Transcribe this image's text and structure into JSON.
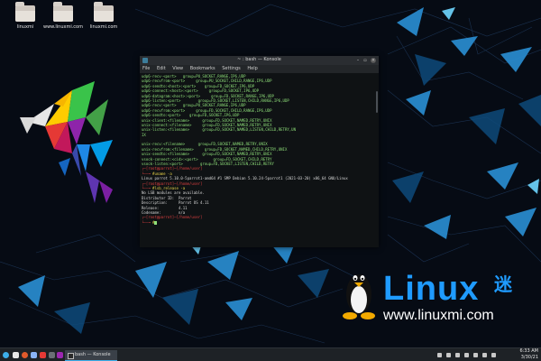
{
  "desktop": {
    "icons": [
      {
        "label": "linuxmi"
      },
      {
        "label": "www.linuxmi.com"
      },
      {
        "label": "linuxmi.com"
      }
    ]
  },
  "window": {
    "title": "~ : bash — Konsole",
    "menu": [
      "File",
      "Edit",
      "View",
      "Bookmarks",
      "Settings",
      "Help"
    ]
  },
  "terminal": {
    "lines": [
      {
        "t": "udp6-recv-<port>   group=PU_SOCKET,RANGE,IP6,UDP",
        "c": "grn"
      },
      {
        "t": "udp6-recvfrom-<port>     group=PU_SOCKET,CHILD,RANGE,IP6,UDP",
        "c": "grn"
      },
      {
        "t": "udp6-sendto:<host>:<port>    group=FD,SOCKET,IP6,UDP",
        "c": "grn"
      },
      {
        "t": "udp6-connect:<host>:<port>     group=FD,SOCKET,IP6,UDP",
        "c": "grn"
      },
      {
        "t": "udp6-datagram:<host>:<port>     group=FD,SOCKET,RANGE,IP6,UDP",
        "c": "grn"
      },
      {
        "t": "udp6-listen:<port>        group=FD,SOCKET,LISTEN,CHILD,RANGE,IP6,UDP",
        "c": "grn"
      },
      {
        "t": "udp6-recv:<port>   group=PU_SOCKET,RANGE,IP6,UDP",
        "c": "grn"
      },
      {
        "t": "udp6-recvfrom:<port>     group=FD,SOCKET,CHILD,RANGE,IP6,UDP",
        "c": "grn"
      },
      {
        "t": "udp6-sendto:<port>    group=FD,SOCKET,IP6,UDP",
        "c": "grn"
      },
      {
        "t": "unix-client:<filename>      group=FD,SOCKET,NAMED,RETRY,UNIX",
        "c": "grn"
      },
      {
        "t": "unix-connect:<filename>     group=FD,SOCKET,NAMED,RETRY,UNIX",
        "c": "grn"
      },
      {
        "t": "unix-listen:<filename>      group=FD,SOCKET,NAMED,LISTEN,CHILD,RETRY,UN",
        "c": "grn"
      },
      {
        "t": "IX",
        "c": "grn"
      },
      {
        "t": "",
        "c": "grn"
      },
      {
        "t": "unix-recv:<filename>      group=FD,SOCKET,NAMED,RETRY,UNIX",
        "c": "grn"
      },
      {
        "t": "unix-recvfrom:<filename>     group=FD,SOCKET,NAMED,CHILD,RETRY,UNIX",
        "c": "grn"
      },
      {
        "t": "unix-sendto:<filename>      group=FD,SOCKET,NAMED,RETRY,UNIX",
        "c": "grn"
      },
      {
        "t": "vsock-connect:<cid>:<port>       group=FD,SOCKET,CHILD,RETRY",
        "c": "grn"
      },
      {
        "t": "vsock-listen:<port>        group=FD,SOCKET,LISTEN,CHILD,RETRY",
        "c": "grn"
      }
    ],
    "prompt1_user": "[root@parrot]",
    "prompt1_path": "[/home/user]",
    "cmd1": "#uname -a",
    "out1": "Linux parrot 5.10.0-5parrot1-amd64 #1 SMP Debian 5.10.24-5parrot1 (2021-03-20) x86_64 GNU/Linux",
    "prompt2_user": "[root@parrot]",
    "prompt2_path": "[/home/user]",
    "cmd2": "#lsb_release -a",
    "out2": [
      "No LSB modules are available.",
      "Distributor ID:  Parrot",
      "Description:     Parrot OS 4.11",
      "Release:         4.11",
      "Codename:        n/a"
    ],
    "prompt3_user": "[root@parrot]",
    "prompt3_path": "[/home/user]",
    "cmd3": "#"
  },
  "brand": {
    "name": "Linux",
    "suffix": "迷",
    "url": "www.linuxmi.com"
  },
  "taskbar": {
    "task_label": "bash — Konsole",
    "time": "6:33 AM",
    "date": "3/30/21"
  },
  "colors": {
    "accent": "#3daee9",
    "brand": "#1f9bff",
    "terminal_text": "#8fe07a",
    "prompt_red": "#e04040"
  }
}
